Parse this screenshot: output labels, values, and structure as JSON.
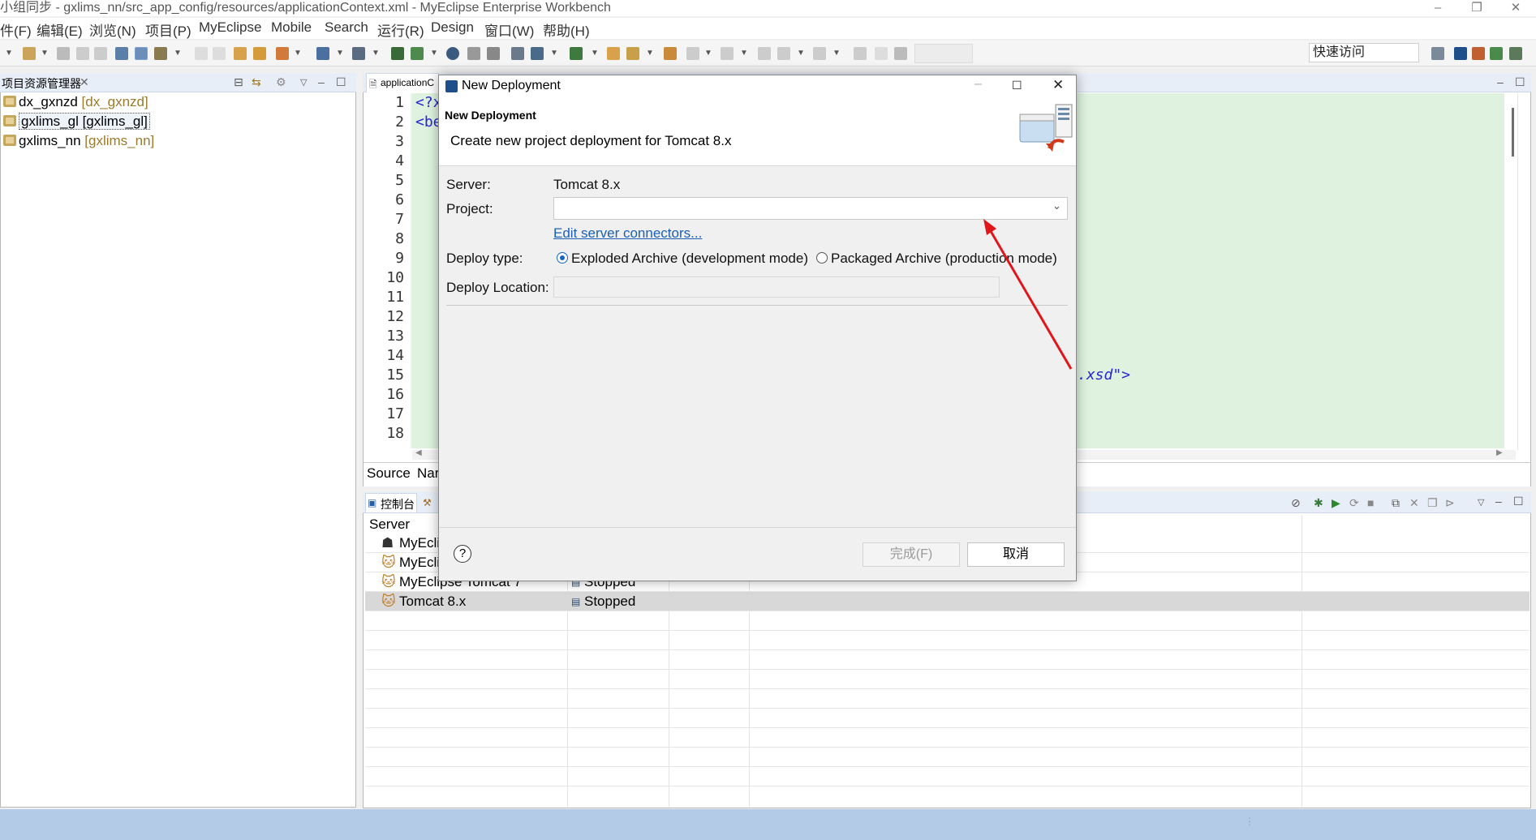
{
  "window": {
    "title": "小组同步 - gxlims_nn/src_app_config/resources/applicationContext.xml - MyEclipse Enterprise Workbench"
  },
  "menu": [
    "件(F)",
    "编辑(E)",
    "浏览(N)",
    "项目(P)",
    "MyEclipse",
    "Mobile",
    "Search",
    "运行(R)",
    "Design",
    "窗口(W)",
    "帮助(H)"
  ],
  "quick_access": {
    "placeholder": "快速访问"
  },
  "left_panel": {
    "title": "项目资源管理器",
    "close": "✕",
    "items": [
      {
        "name": "dx_gxnzd",
        "decoration": "[dx_gxnzd]"
      },
      {
        "name": "gxlims_gl [gxlims_gl]",
        "decoration": ""
      },
      {
        "name": "gxlims_nn",
        "decoration": "[gxlims_nn]"
      }
    ]
  },
  "editor": {
    "tab": "applicationC",
    "line_numbers": [
      "1",
      "2",
      "3",
      "4",
      "5",
      "6",
      "7",
      "8",
      "9",
      "10",
      "11",
      "12",
      "13",
      "14",
      "15",
      "16",
      "17",
      "18"
    ],
    "code_line1": "<?x",
    "code_line2": "<be",
    "code_visible_tail": ".xsd\">",
    "bottom_tabs": [
      "Source",
      "Nar"
    ]
  },
  "console": {
    "tab_label": "控制台",
    "header": "Server",
    "rows": [
      {
        "name": "MyEcli",
        "status": ""
      },
      {
        "name": "MyEcli",
        "status": ""
      },
      {
        "name": "MyEclipse Tomcat 7",
        "status": "Stopped"
      },
      {
        "name": "Tomcat  8.x",
        "status": "Stopped"
      }
    ]
  },
  "dialog": {
    "title": "New Deployment",
    "heading": "New Deployment",
    "description": "Create new project deployment for Tomcat  8.x",
    "server_label": "Server:",
    "server_value": "Tomcat  8.x",
    "project_label": "Project:",
    "project_value": "",
    "edit_connectors_link": "Edit server connectors...",
    "deploy_type_label": "Deploy type:",
    "deploy_option_exploded": "Exploded Archive (development mode)",
    "deploy_option_packaged": "Packaged Archive (production mode)",
    "deploy_location_label": "Deploy Location:",
    "deploy_location_value": "",
    "finish_button": "完成(F)",
    "cancel_button": "取消",
    "help": "?"
  },
  "colors": {
    "accent_link": "#1a5fb4",
    "annotation_arrow": "#e0161b",
    "code_bg": "#dff2df",
    "status_bar": "#b3cbe6"
  }
}
